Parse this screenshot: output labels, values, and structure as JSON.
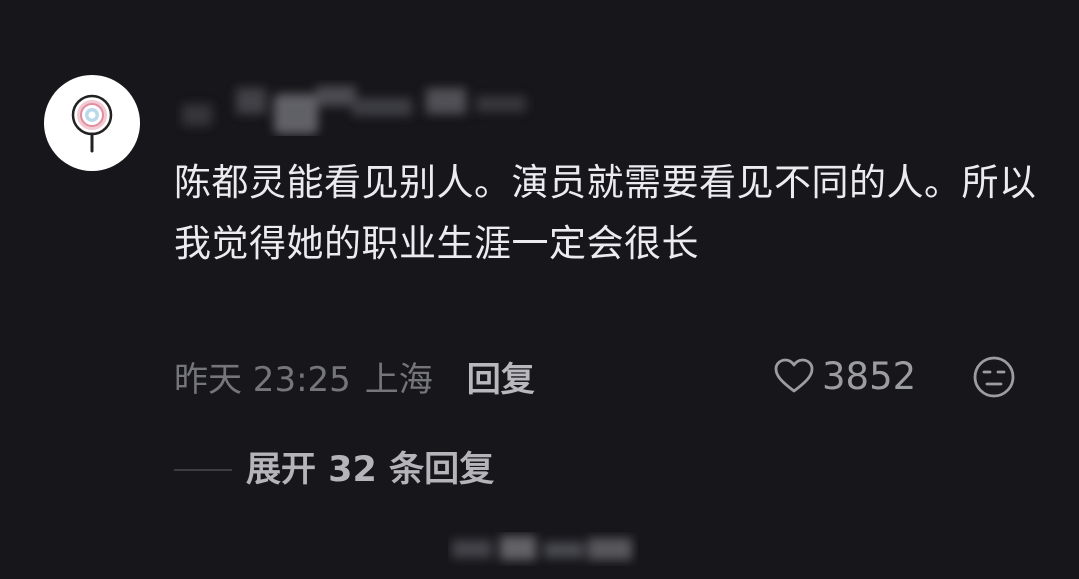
{
  "comment": {
    "text": "陈都灵能看见别人。演员就需要看见不同的人。所以我觉得她的职业生涯一定会很长",
    "time": "昨天 23:25",
    "location": "上海",
    "reply_label": "回复",
    "like_count": "3852"
  },
  "replies": {
    "expand_label": "展开 32 条回复"
  },
  "icons": {
    "avatar": "lollipop-icon",
    "like": "heart-outline-icon",
    "emoji": "neutral-face-icon"
  },
  "colors": {
    "background": "#16161b",
    "text": "#ececef",
    "muted": "#75757c",
    "reply": "#b8b8be"
  }
}
